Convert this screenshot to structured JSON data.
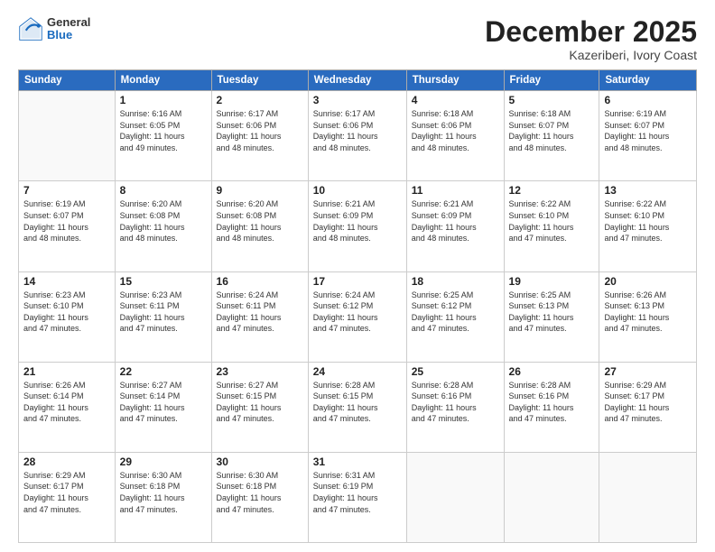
{
  "header": {
    "logo_general": "General",
    "logo_blue": "Blue",
    "month_title": "December 2025",
    "location": "Kazeriberi, Ivory Coast"
  },
  "calendar": {
    "days_of_week": [
      "Sunday",
      "Monday",
      "Tuesday",
      "Wednesday",
      "Thursday",
      "Friday",
      "Saturday"
    ],
    "weeks": [
      [
        {
          "day": "",
          "info": ""
        },
        {
          "day": "1",
          "info": "Sunrise: 6:16 AM\nSunset: 6:05 PM\nDaylight: 11 hours\nand 49 minutes."
        },
        {
          "day": "2",
          "info": "Sunrise: 6:17 AM\nSunset: 6:06 PM\nDaylight: 11 hours\nand 48 minutes."
        },
        {
          "day": "3",
          "info": "Sunrise: 6:17 AM\nSunset: 6:06 PM\nDaylight: 11 hours\nand 48 minutes."
        },
        {
          "day": "4",
          "info": "Sunrise: 6:18 AM\nSunset: 6:06 PM\nDaylight: 11 hours\nand 48 minutes."
        },
        {
          "day": "5",
          "info": "Sunrise: 6:18 AM\nSunset: 6:07 PM\nDaylight: 11 hours\nand 48 minutes."
        },
        {
          "day": "6",
          "info": "Sunrise: 6:19 AM\nSunset: 6:07 PM\nDaylight: 11 hours\nand 48 minutes."
        }
      ],
      [
        {
          "day": "7",
          "info": "Sunrise: 6:19 AM\nSunset: 6:07 PM\nDaylight: 11 hours\nand 48 minutes."
        },
        {
          "day": "8",
          "info": "Sunrise: 6:20 AM\nSunset: 6:08 PM\nDaylight: 11 hours\nand 48 minutes."
        },
        {
          "day": "9",
          "info": "Sunrise: 6:20 AM\nSunset: 6:08 PM\nDaylight: 11 hours\nand 48 minutes."
        },
        {
          "day": "10",
          "info": "Sunrise: 6:21 AM\nSunset: 6:09 PM\nDaylight: 11 hours\nand 48 minutes."
        },
        {
          "day": "11",
          "info": "Sunrise: 6:21 AM\nSunset: 6:09 PM\nDaylight: 11 hours\nand 48 minutes."
        },
        {
          "day": "12",
          "info": "Sunrise: 6:22 AM\nSunset: 6:10 PM\nDaylight: 11 hours\nand 47 minutes."
        },
        {
          "day": "13",
          "info": "Sunrise: 6:22 AM\nSunset: 6:10 PM\nDaylight: 11 hours\nand 47 minutes."
        }
      ],
      [
        {
          "day": "14",
          "info": "Sunrise: 6:23 AM\nSunset: 6:10 PM\nDaylight: 11 hours\nand 47 minutes."
        },
        {
          "day": "15",
          "info": "Sunrise: 6:23 AM\nSunset: 6:11 PM\nDaylight: 11 hours\nand 47 minutes."
        },
        {
          "day": "16",
          "info": "Sunrise: 6:24 AM\nSunset: 6:11 PM\nDaylight: 11 hours\nand 47 minutes."
        },
        {
          "day": "17",
          "info": "Sunrise: 6:24 AM\nSunset: 6:12 PM\nDaylight: 11 hours\nand 47 minutes."
        },
        {
          "day": "18",
          "info": "Sunrise: 6:25 AM\nSunset: 6:12 PM\nDaylight: 11 hours\nand 47 minutes."
        },
        {
          "day": "19",
          "info": "Sunrise: 6:25 AM\nSunset: 6:13 PM\nDaylight: 11 hours\nand 47 minutes."
        },
        {
          "day": "20",
          "info": "Sunrise: 6:26 AM\nSunset: 6:13 PM\nDaylight: 11 hours\nand 47 minutes."
        }
      ],
      [
        {
          "day": "21",
          "info": "Sunrise: 6:26 AM\nSunset: 6:14 PM\nDaylight: 11 hours\nand 47 minutes."
        },
        {
          "day": "22",
          "info": "Sunrise: 6:27 AM\nSunset: 6:14 PM\nDaylight: 11 hours\nand 47 minutes."
        },
        {
          "day": "23",
          "info": "Sunrise: 6:27 AM\nSunset: 6:15 PM\nDaylight: 11 hours\nand 47 minutes."
        },
        {
          "day": "24",
          "info": "Sunrise: 6:28 AM\nSunset: 6:15 PM\nDaylight: 11 hours\nand 47 minutes."
        },
        {
          "day": "25",
          "info": "Sunrise: 6:28 AM\nSunset: 6:16 PM\nDaylight: 11 hours\nand 47 minutes."
        },
        {
          "day": "26",
          "info": "Sunrise: 6:28 AM\nSunset: 6:16 PM\nDaylight: 11 hours\nand 47 minutes."
        },
        {
          "day": "27",
          "info": "Sunrise: 6:29 AM\nSunset: 6:17 PM\nDaylight: 11 hours\nand 47 minutes."
        }
      ],
      [
        {
          "day": "28",
          "info": "Sunrise: 6:29 AM\nSunset: 6:17 PM\nDaylight: 11 hours\nand 47 minutes."
        },
        {
          "day": "29",
          "info": "Sunrise: 6:30 AM\nSunset: 6:18 PM\nDaylight: 11 hours\nand 47 minutes."
        },
        {
          "day": "30",
          "info": "Sunrise: 6:30 AM\nSunset: 6:18 PM\nDaylight: 11 hours\nand 47 minutes."
        },
        {
          "day": "31",
          "info": "Sunrise: 6:31 AM\nSunset: 6:19 PM\nDaylight: 11 hours\nand 47 minutes."
        },
        {
          "day": "",
          "info": ""
        },
        {
          "day": "",
          "info": ""
        },
        {
          "day": "",
          "info": ""
        }
      ]
    ]
  }
}
